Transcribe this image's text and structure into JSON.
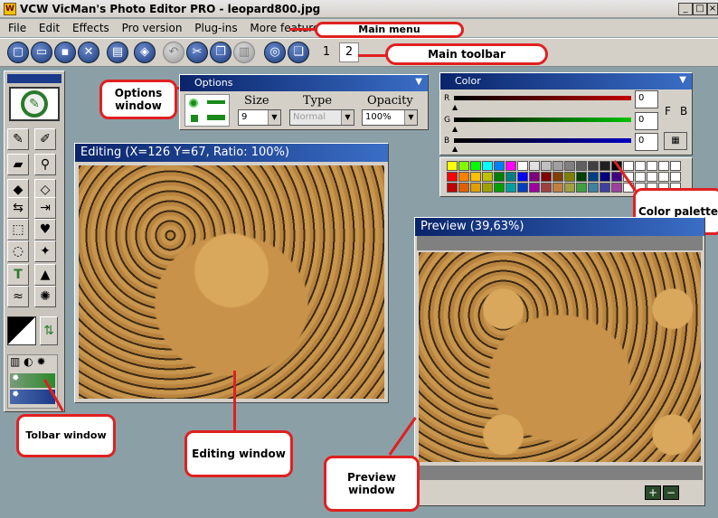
{
  "window": {
    "title": "VCW VicMan's Photo Editor PRO - leopard800.jpg",
    "icon_label": "W"
  },
  "menu": [
    "File",
    "Edit",
    "Effects",
    "Pro version",
    "Plug-ins",
    "More features",
    "?"
  ],
  "toolbar": {
    "buttons": [
      "new-icon",
      "open-icon",
      "save-icon",
      "close-icon",
      "print-icon",
      "scan-icon",
      "undo-icon",
      "cut-icon",
      "copy-icon",
      "paste-icon",
      "zoom-icon",
      "window-icon"
    ],
    "tabs": [
      "1",
      "2"
    ],
    "selected_tab": "2"
  },
  "callouts": {
    "main_menu": "Main menu",
    "main_toolbar": "Main toolbar",
    "options": "Options window",
    "color_palette": "Color palette",
    "toolbar_window": "Tolbar window",
    "editing": "Editing window",
    "preview": "Preview window"
  },
  "options": {
    "title": "Options",
    "size_label": "Size",
    "size_value": "9",
    "type_label": "Type",
    "type_value": "Normal",
    "opacity_label": "Opacity",
    "opacity_value": "100%"
  },
  "color": {
    "title": "Color",
    "r_label": "R",
    "g_label": "G",
    "b_label": "B",
    "r_value": "0",
    "g_value": "0",
    "b_value": "0",
    "f_label": "F",
    "b2_label": "B"
  },
  "palette": {
    "row1": [
      "#ffff00",
      "#80ff00",
      "#00ff00",
      "#00ffff",
      "#0080ff",
      "#ff00ff",
      "#ffffff",
      "#e0e0e0",
      "#c0c0c0",
      "#a0a0a0",
      "#808080",
      "#606060",
      "#404040",
      "#202020",
      "#000000",
      "#ffffff",
      "#ffffff",
      "#ffffff",
      "#ffffff",
      "#ffffff"
    ],
    "row2": [
      "#ff0000",
      "#ff8000",
      "#ffc000",
      "#c0c000",
      "#008000",
      "#008080",
      "#0000ff",
      "#800080",
      "#800000",
      "#804000",
      "#808000",
      "#004000",
      "#004080",
      "#000080",
      "#400080",
      "#ffffff",
      "#ffffff",
      "#ffffff",
      "#ffffff",
      "#ffffff"
    ],
    "row3": [
      "#c00000",
      "#e06000",
      "#e0a000",
      "#a0a000",
      "#00a000",
      "#00a0a0",
      "#0040c0",
      "#a000a0",
      "#a04040",
      "#c08040",
      "#a0a040",
      "#40a040",
      "#4080a0",
      "#4040a0",
      "#a040a0",
      "#ffffff",
      "#ffffff",
      "#ffffff",
      "#ffffff",
      "#ffffff"
    ]
  },
  "editing": {
    "title": "Editing (X=126 Y=67, Ratio: 100%)"
  },
  "preview": {
    "title": "Preview (39,63%)",
    "zoom_in": "+",
    "zoom_out": "−"
  }
}
